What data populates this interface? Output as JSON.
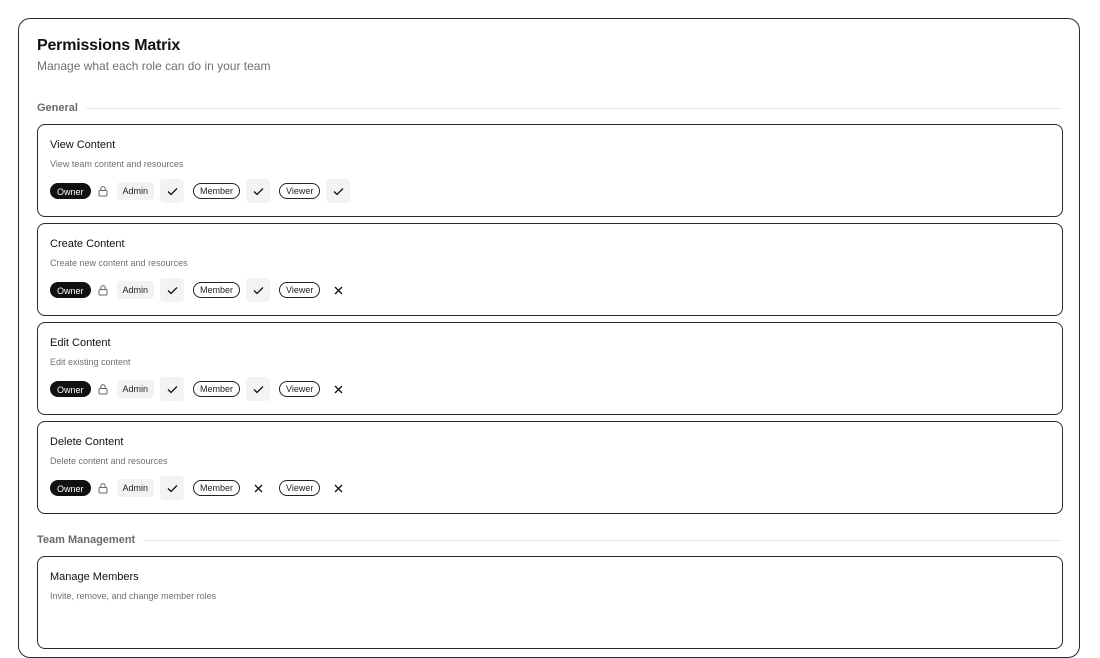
{
  "header": {
    "title": "Permissions Matrix",
    "subtitle": "Manage what each role can do in your team"
  },
  "roles": {
    "owner": "Owner",
    "admin": "Admin",
    "member": "Member",
    "viewer": "Viewer"
  },
  "sections": [
    {
      "title": "General",
      "permissions": [
        {
          "name": "View Content",
          "description": "View team content and resources",
          "admin": true,
          "member": true,
          "viewer": true
        },
        {
          "name": "Create Content",
          "description": "Create new content and resources",
          "admin": true,
          "member": true,
          "viewer": false
        },
        {
          "name": "Edit Content",
          "description": "Edit existing content",
          "admin": true,
          "member": true,
          "viewer": false
        },
        {
          "name": "Delete Content",
          "description": "Delete content and resources",
          "admin": true,
          "member": false,
          "viewer": false
        }
      ]
    },
    {
      "title": "Team Management",
      "permissions": [
        {
          "name": "Manage Members",
          "description": "Invite, remove, and change member roles"
        }
      ]
    }
  ],
  "icons": {
    "owner_lock": "lock-icon",
    "granted": "check-icon",
    "denied": "x-icon"
  }
}
